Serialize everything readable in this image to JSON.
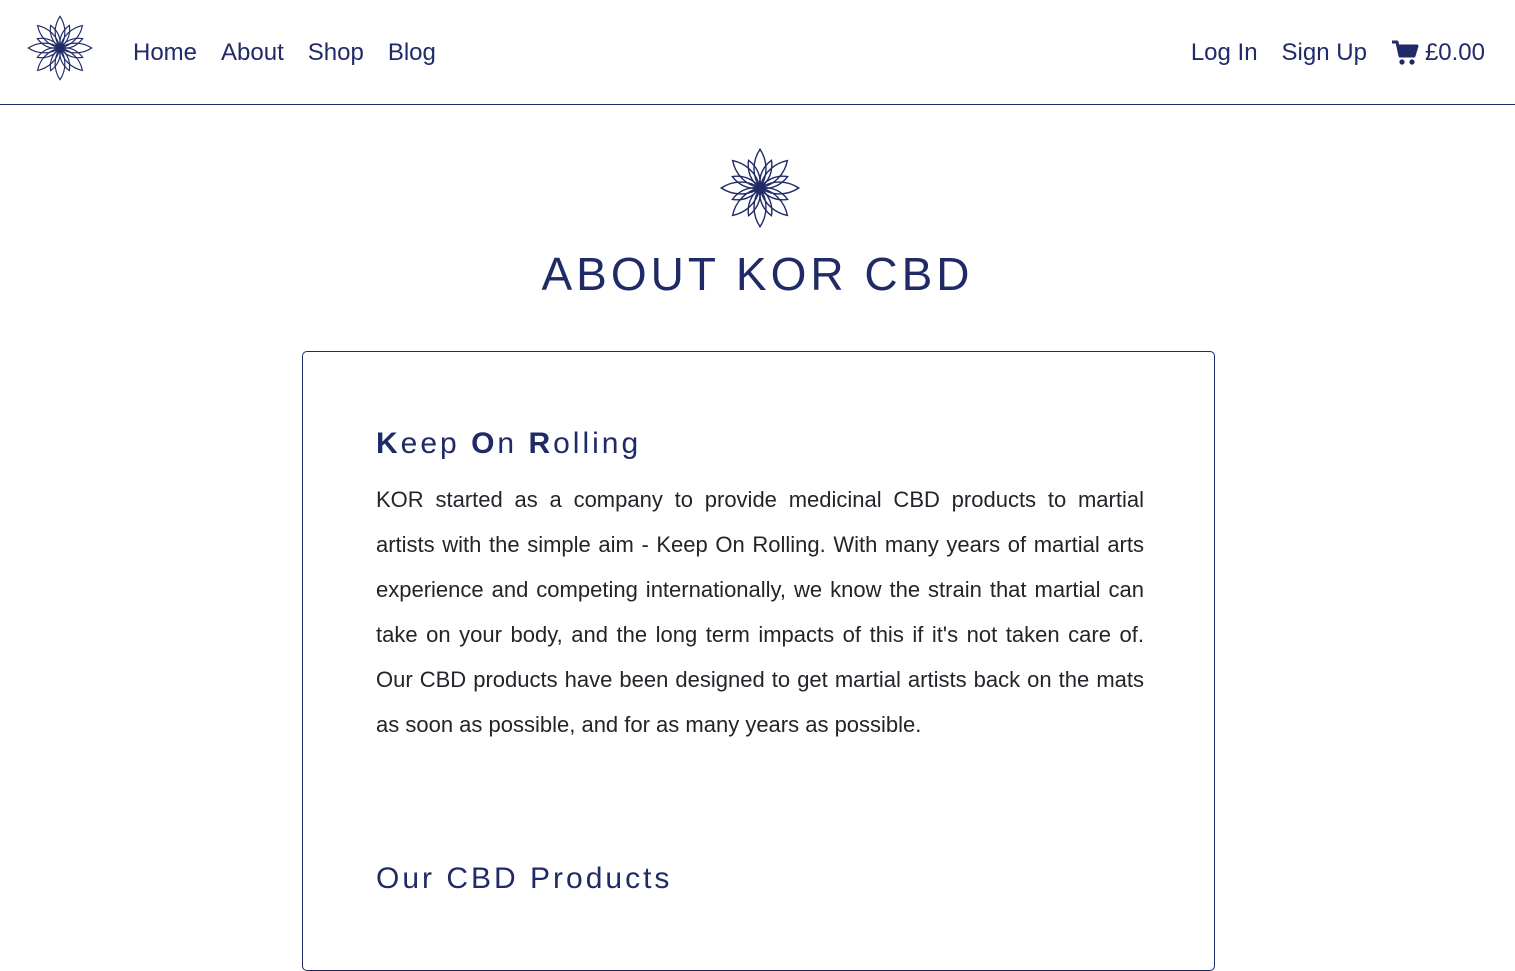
{
  "nav": {
    "links": [
      {
        "label": "Home"
      },
      {
        "label": "About"
      },
      {
        "label": "Shop"
      },
      {
        "label": "Blog"
      }
    ],
    "login_label": "Log In",
    "signup_label": "Sign Up",
    "cart_total": "£0.00",
    "logo_icon": "lotus-logo-icon",
    "cart_icon": "shopping-cart-icon"
  },
  "page": {
    "title": "ABOUT KOR CBD"
  },
  "sections": [
    {
      "heading_parts": [
        "K",
        "eep ",
        "O",
        "n ",
        "R",
        "olling"
      ],
      "body": "KOR started as a company to provide medicinal CBD products to martial artists with the simple aim - Keep On Rolling. With many years of martial arts experience and competing internationally, we know the strain that martial can take on your body, and the long term impacts of this if it's not taken care of. Our CBD products have been designed to get martial artists back on the mats as soon as possible, and for as many years as possible."
    },
    {
      "heading": "Our CBD Products"
    }
  ],
  "colors": {
    "brand_navy": "#202a67",
    "body_text": "#212529",
    "background": "#ffffff"
  }
}
